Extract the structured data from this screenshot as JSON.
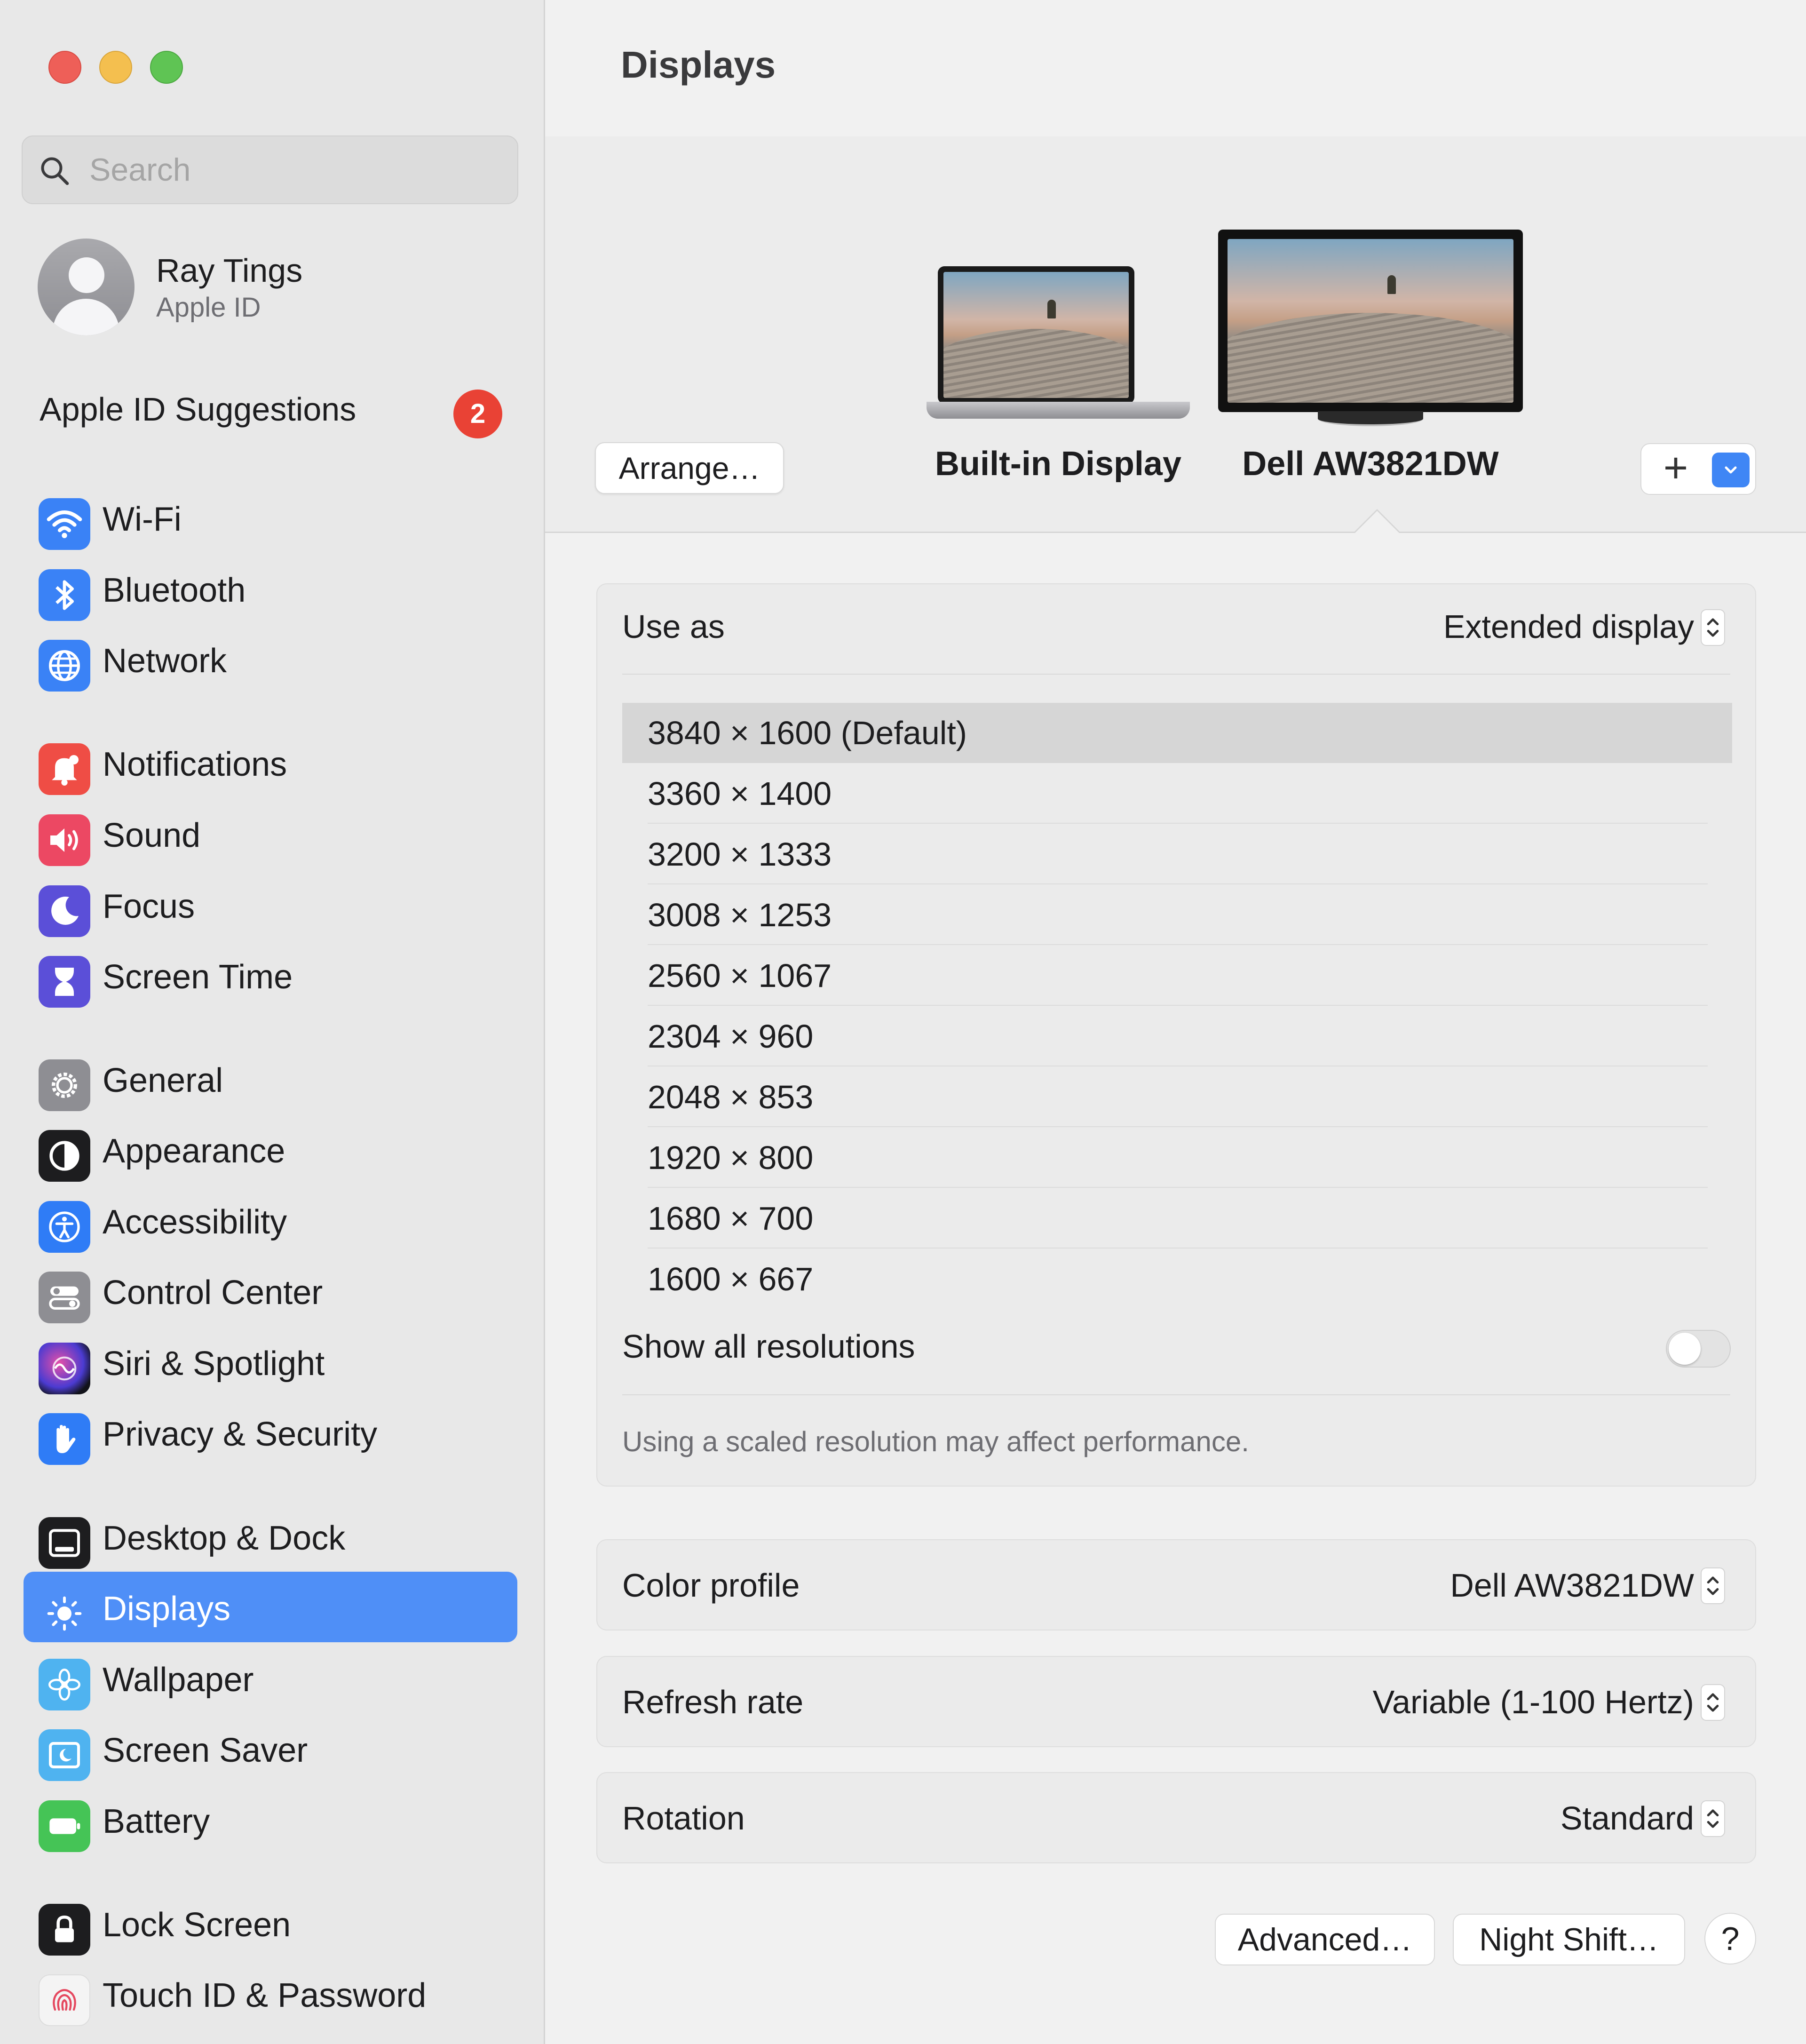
{
  "window": {
    "title": "Displays"
  },
  "sidebar": {
    "search": {
      "placeholder": "Search",
      "value": ""
    },
    "profile": {
      "name": "Ray Tings",
      "subtitle": "Apple ID"
    },
    "suggestions": {
      "label": "Apple ID Suggestions",
      "count": "2"
    },
    "items": [
      {
        "label": "Wi-Fi",
        "icon": "wifi-icon",
        "color": "#3a82f6"
      },
      {
        "label": "Bluetooth",
        "icon": "bluetooth-icon",
        "color": "#3a82f6"
      },
      {
        "label": "Network",
        "icon": "globe-icon",
        "color": "#3a82f6"
      },
      {
        "label": "Notifications",
        "icon": "bell-icon",
        "color": "#ef4d45"
      },
      {
        "label": "Sound",
        "icon": "speaker-icon",
        "color": "#ec4863"
      },
      {
        "label": "Focus",
        "icon": "moon-icon",
        "color": "#5b4fd8"
      },
      {
        "label": "Screen Time",
        "icon": "hourglass-icon",
        "color": "#5b4fd8"
      },
      {
        "label": "General",
        "icon": "gear-icon",
        "color": "#8e8e93"
      },
      {
        "label": "Appearance",
        "icon": "appearance-icon",
        "color": "#1d1d1f"
      },
      {
        "label": "Accessibility",
        "icon": "accessibility-icon",
        "color": "#2f7cf6"
      },
      {
        "label": "Control Center",
        "icon": "toggles-icon",
        "color": "#8e8e93"
      },
      {
        "label": "Siri & Spotlight",
        "icon": "siri-icon",
        "color": "#7d3fd0"
      },
      {
        "label": "Privacy & Security",
        "icon": "hand-icon",
        "color": "#2f7cf6"
      },
      {
        "label": "Desktop & Dock",
        "icon": "dock-icon",
        "color": "#1d1d1f"
      },
      {
        "label": "Displays",
        "icon": "sun-icon",
        "color": "#2f7cf6",
        "active": true
      },
      {
        "label": "Wallpaper",
        "icon": "flower-icon",
        "color": "#4fb3f0"
      },
      {
        "label": "Screen Saver",
        "icon": "screensaver-icon",
        "color": "#4fb3f0"
      },
      {
        "label": "Battery",
        "icon": "battery-icon",
        "color": "#45c456"
      },
      {
        "label": "Lock Screen",
        "icon": "lock-icon",
        "color": "#1d1d1f"
      },
      {
        "label": "Touch ID & Password",
        "icon": "fingerprint-icon",
        "color": "#f4f4f4"
      }
    ]
  },
  "header": {
    "arrange_label": "Arrange…",
    "displays": [
      {
        "name": "Built-in Display"
      },
      {
        "name": "Dell AW3821DW",
        "selected": true
      }
    ]
  },
  "settings": {
    "use_as": {
      "label": "Use as",
      "value": "Extended display"
    },
    "resolutions": [
      "3840 × 1600 (Default)",
      "3360 × 1400",
      "3200 × 1333",
      "3008 × 1253",
      "2560 × 1067",
      "2304 × 960",
      "2048 × 853",
      "1920 × 800",
      "1680 × 700",
      "1600 × 667"
    ],
    "selected_resolution": "3840 × 1600 (Default)",
    "show_all": {
      "label": "Show all resolutions",
      "enabled": false
    },
    "note": "Using a scaled resolution may affect performance.",
    "color_profile": {
      "label": "Color profile",
      "value": "Dell AW3821DW"
    },
    "refresh_rate": {
      "label": "Refresh rate",
      "value": "Variable (1-100 Hertz)"
    },
    "rotation": {
      "label": "Rotation",
      "value": "Standard"
    }
  },
  "footer": {
    "advanced_label": "Advanced…",
    "night_shift_label": "Night Shift…",
    "help_label": "?"
  },
  "colors": {
    "accent": "#4f8ff7",
    "badge": "#e94235"
  }
}
